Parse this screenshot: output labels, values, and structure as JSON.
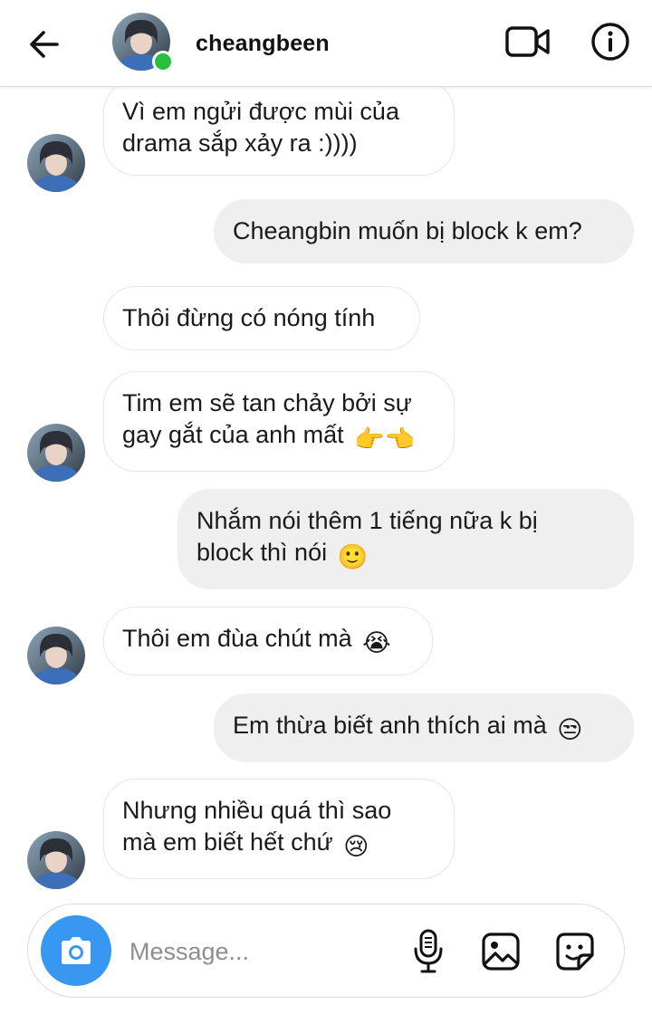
{
  "header": {
    "back_icon": "arrow-left-icon",
    "username": "cheangbeen",
    "online": true,
    "online_color": "#25c03f",
    "video_icon": "video-camera-icon",
    "info_icon": "info-circle-icon"
  },
  "thread": {
    "messages": [
      {
        "direction": "incoming",
        "lines": [
          "Vì em ngửi được mùi của",
          "drama sắp xảy ra :))))"
        ]
      },
      {
        "direction": "outgoing",
        "lines": [
          "Cheangbin muốn bị block k em?"
        ]
      },
      {
        "direction": "incoming",
        "lines": [
          "Thôi đừng có nóng tính"
        ]
      },
      {
        "direction": "incoming",
        "lines": [
          "Tim em sẽ tan chảy bởi sự",
          "gay gắt của anh mất"
        ],
        "emoji": "👉👈"
      },
      {
        "direction": "outgoing",
        "lines": [
          "Nhắm nói thêm 1 tiếng nữa k bị",
          "block thì nói"
        ],
        "emoji": "🙂"
      },
      {
        "direction": "incoming",
        "lines": [
          "Thôi em đùa chút mà"
        ],
        "emoji": "😭"
      },
      {
        "direction": "outgoing",
        "lines": [
          "Em thừa biết anh thích ai mà"
        ],
        "emoji": "😒"
      },
      {
        "direction": "incoming",
        "lines": [
          "Nhưng nhiều quá thì sao",
          "mà em biết hết chứ"
        ],
        "emoji": "😢"
      }
    ]
  },
  "composer": {
    "camera_icon": "camera-icon",
    "placeholder": "Message...",
    "value": "",
    "mic_icon": "microphone-icon",
    "gallery_icon": "image-gallery-icon",
    "sticker_icon": "sticker-icon",
    "accent_color": "#3897f0"
  },
  "colors": {
    "incoming_bubble": "#ffffff",
    "outgoing_bubble": "#efefef"
  }
}
